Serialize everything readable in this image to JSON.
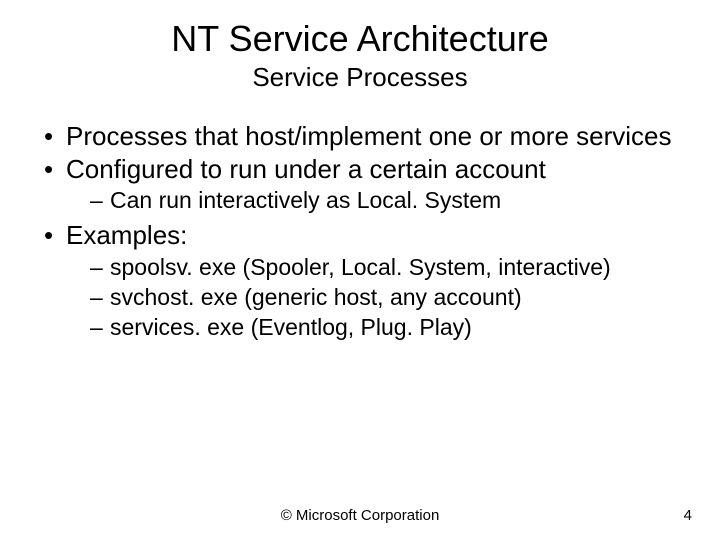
{
  "title": "NT Service Architecture",
  "subtitle": "Service Processes",
  "bullets": {
    "b0": "Processes that host/implement one or more services",
    "b1": "Configured to run under a certain account",
    "b1s0": "Can run interactively as Local. System",
    "b2": "Examples:",
    "b2s0": "spoolsv. exe (Spooler, Local. System, interactive)",
    "b2s1": "svchost. exe (generic host, any account)",
    "b2s2": "services. exe (Eventlog, Plug. Play)"
  },
  "footer": {
    "copyright": "© Microsoft Corporation",
    "page": "4"
  }
}
